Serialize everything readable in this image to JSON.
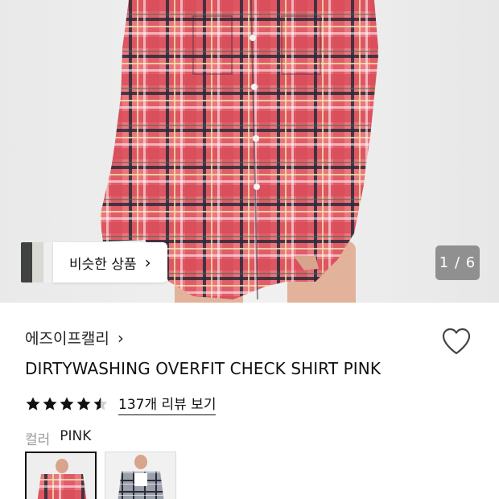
{
  "hero": {
    "pager": "1 / 6",
    "similar_label": "비슷한 상품",
    "similar_chevron": "›"
  },
  "product": {
    "brand": "에즈이프캘리",
    "brand_chevron": "›",
    "name": "DIRTYWASHING OVERFIT CHECK SHIRT PINK",
    "rating": 4.5,
    "review_link": "137개 리뷰 보기",
    "color_label": "컬러",
    "color_value": "PINK",
    "icons": {
      "wishlist": "heart-outline-icon",
      "star": "star-icon"
    }
  },
  "colors": {
    "accent": "#111111",
    "muted": "#9a9a9a",
    "shirt_pink": "#e8707a",
    "check_dark": "#2b2b3a"
  }
}
